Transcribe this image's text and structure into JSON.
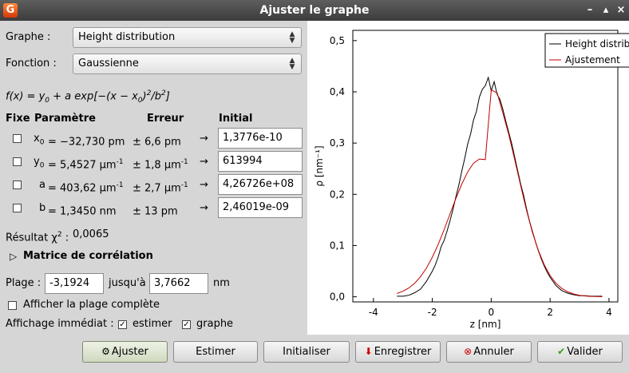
{
  "window": {
    "title": "Ajuster le graphe",
    "app_icon": "gwyddion-icon",
    "controls": [
      "–",
      "▴",
      "×"
    ]
  },
  "form": {
    "graph_label": "Graphe :",
    "graph_value": "Height distribution",
    "function_label": "Fonction :",
    "function_value": "Gaussienne"
  },
  "formula": {
    "fx": "f(x)",
    "eq1": " = y",
    "sub1": "0",
    "eq2": " + a exp[−(x − x",
    "sub2": "0",
    "eq3": ")",
    "sup1": "2",
    "eq4": "/b",
    "sup2": "2",
    "eq5": "]"
  },
  "params_header": {
    "fixe": "Fixe",
    "param": "Paramètre",
    "erreur": "Erreur",
    "initial": "Initial"
  },
  "params": [
    {
      "name": "x",
      "sub": "0",
      "value": "= −32,730 pm",
      "value_sup": "",
      "error": "± 6,6 pm",
      "error_sup": "",
      "arrow": "→",
      "initial": "1,3776e-10"
    },
    {
      "name": "y",
      "sub": "0",
      "value": "= 5,4527 μm",
      "value_sup": "-1",
      "error": "± 1,8 μm",
      "error_sup": "-1",
      "arrow": "→",
      "initial": "613994"
    },
    {
      "name": "a",
      "sub": "",
      "value": "= 403,62 μm",
      "value_sup": "-1",
      "error": "± 2,7 μm",
      "error_sup": "-1",
      "arrow": "→",
      "initial": "4,26726e+08"
    },
    {
      "name": "b",
      "sub": "",
      "value": "= 1,3450 nm",
      "value_sup": "",
      "error": "± 13 pm",
      "error_sup": "",
      "arrow": "→",
      "initial": "2,46019e-09"
    }
  ],
  "result": {
    "label": "Résultat χ",
    "sup": "2",
    "colon": " :",
    "value": "0,0065"
  },
  "correlation": {
    "label": "Matrice de corrélation",
    "expander": "▷"
  },
  "range": {
    "label": "Plage :",
    "from": "-3,1924",
    "to_label": "jusqu'à",
    "to": "3,7662",
    "unit": "nm"
  },
  "full_range": {
    "label": "Afficher la plage complète",
    "checked": false
  },
  "instant": {
    "label": "Affichage immédiat :",
    "estimate_label": "estimer",
    "estimate_checked": true,
    "graph_label": "graphe",
    "graph_checked": true
  },
  "buttons": {
    "fit": "Ajuster",
    "estimate": "Estimer",
    "init": "Initialiser",
    "save": "Enregistrer",
    "cancel": "Annuler",
    "ok": "Valider"
  },
  "chart_data": {
    "type": "line",
    "xlabel": "z [nm]",
    "ylabel": "ρ [nm⁻¹]",
    "xlim": [
      -4.7,
      4.3
    ],
    "ylim": [
      -0.01,
      0.52
    ],
    "xticks": [
      -4,
      -2,
      0,
      2,
      4
    ],
    "xtick_labels": [
      "-4",
      "-2",
      "0",
      "2",
      "4"
    ],
    "yticks": [
      0.0,
      0.1,
      0.2,
      0.3,
      0.4,
      0.5
    ],
    "ytick_labels": [
      "0,0",
      "0,1",
      "0,2",
      "0,3",
      "0,4",
      "0,5"
    ],
    "legend_position": "top-right",
    "series": [
      {
        "name": "Height distribution",
        "color": "#000000",
        "x": [
          -3.2,
          -3.0,
          -2.8,
          -2.6,
          -2.4,
          -2.2,
          -2.0,
          -1.9,
          -1.8,
          -1.7,
          -1.6,
          -1.5,
          -1.4,
          -1.3,
          -1.2,
          -1.1,
          -1.0,
          -0.9,
          -0.8,
          -0.7,
          -0.6,
          -0.5,
          -0.4,
          -0.3,
          -0.2,
          -0.1,
          0.0,
          0.1,
          0.2,
          0.3,
          0.4,
          0.5,
          0.6,
          0.7,
          0.8,
          0.9,
          1.0,
          1.1,
          1.2,
          1.3,
          1.4,
          1.5,
          1.6,
          1.7,
          1.8,
          1.9,
          2.0,
          2.2,
          2.4,
          2.6,
          2.8,
          3.0,
          3.2,
          3.4,
          3.6,
          3.77
        ],
        "y": [
          0.001,
          0.001,
          0.003,
          0.008,
          0.015,
          0.03,
          0.05,
          0.062,
          0.078,
          0.098,
          0.11,
          0.128,
          0.148,
          0.17,
          0.195,
          0.218,
          0.245,
          0.27,
          0.298,
          0.318,
          0.345,
          0.362,
          0.39,
          0.405,
          0.412,
          0.428,
          0.402,
          0.42,
          0.395,
          0.385,
          0.365,
          0.342,
          0.32,
          0.298,
          0.272,
          0.246,
          0.22,
          0.198,
          0.172,
          0.148,
          0.128,
          0.108,
          0.09,
          0.074,
          0.06,
          0.048,
          0.038,
          0.022,
          0.012,
          0.007,
          0.004,
          0.002,
          0.002,
          0.001,
          0.001,
          0.001
        ]
      },
      {
        "name": "Ajustement",
        "color": "#c00000",
        "x": [
          -3.2,
          -3.0,
          -2.8,
          -2.6,
          -2.4,
          -2.2,
          -2.0,
          -1.8,
          -1.6,
          -1.4,
          -1.2,
          -1.0,
          -0.8,
          -0.6,
          -0.4,
          -0.2,
          0.0,
          0.2,
          0.4,
          0.6,
          0.8,
          1.0,
          1.2,
          1.4,
          1.6,
          1.8,
          2.0,
          2.2,
          2.4,
          2.6,
          2.8,
          3.0,
          3.2,
          3.4,
          3.6,
          3.77
        ],
        "y": [
          0.0066,
          0.0108,
          0.0172,
          0.0265,
          0.0393,
          0.0561,
          0.0772,
          0.1025,
          0.131,
          0.1614,
          0.1918,
          0.22,
          0.2437,
          0.2606,
          0.2689,
          0.2678,
          0.4036,
          0.398,
          0.358,
          0.316,
          0.267,
          0.217,
          0.169,
          0.126,
          0.0905,
          0.0625,
          0.0415,
          0.0265,
          0.0163,
          0.0096,
          0.0055,
          0.003,
          0.0016,
          0.0008,
          0.0004,
          0.0002
        ]
      }
    ]
  }
}
